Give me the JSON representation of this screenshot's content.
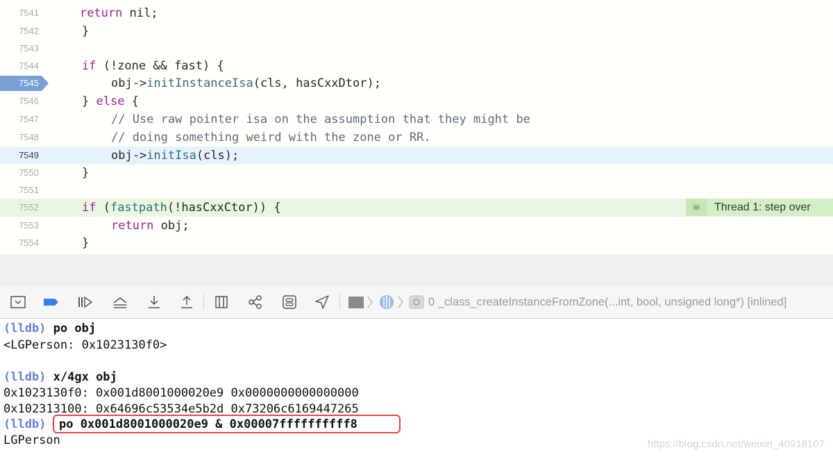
{
  "editor": {
    "lines": [
      {
        "num": "7541"
      },
      {
        "num": "7542"
      },
      {
        "num": "7543"
      },
      {
        "num": "7544"
      },
      {
        "num": "7545"
      },
      {
        "num": "7546"
      },
      {
        "num": "7547"
      },
      {
        "num": "7548"
      },
      {
        "num": "7549"
      },
      {
        "num": "7550"
      },
      {
        "num": "7551"
      },
      {
        "num": "7552"
      },
      {
        "num": "7553"
      },
      {
        "num": "7554"
      }
    ],
    "code": {
      "l7541_kw": "return",
      "l7541_rest": " nil;",
      "l7542": "}",
      "l7544_kw": "if",
      "l7544_rest": " (!zone && fast) {",
      "l7545_a": "obj->",
      "l7545_fn": "initInstanceIsa",
      "l7545_b": "(cls, hasCxxDtor);",
      "l7546_a": "} ",
      "l7546_kw": "else",
      "l7546_b": " {",
      "l7547": "// Use raw pointer isa on the assumption that they might be",
      "l7548": "// doing something weird with the zone or RR.",
      "l7549_a": "obj->",
      "l7549_fn": "initIsa",
      "l7549_b": "(cls);",
      "l7550": "}",
      "l7552_kw": "if",
      "l7552_a": " (",
      "l7552_fn": "fastpath",
      "l7552_b": "(!hasCxxCtor)) {",
      "l7553_kw": "return",
      "l7553_rest": " obj;",
      "l7554": "}"
    },
    "thread_badge": {
      "icon": "≡",
      "text": "Thread 1: step over"
    }
  },
  "toolbar": {
    "frame_label": "0 _class_createInstanceFromZone(...int, bool, unsigned long*) [inlined]"
  },
  "console": {
    "prompt": "(lldb)",
    "cmd1": " po obj",
    "out1": "<LGPerson: 0x1023130f0>",
    "cmd2": " x/4gx obj",
    "out2": "0x1023130f0: 0x001d8001000020e9 0x0000000000000000",
    "out3": "0x102313100: 0x64696c53534e5b2d 0x73206c6169447265",
    "cmd3": "po 0x001d8001000020e9 & 0x00007ffffffffff8",
    "out4": "LGPerson",
    "watermark": "https://blog.csdn.net/weixin_40918107"
  },
  "colors": {
    "keyword": "#9b2393",
    "function": "#326d74",
    "comment": "#5d6c79",
    "breakpoint": "#78a0d7",
    "current_line": "#e8f2fe",
    "thread_line": "#e9f7e2",
    "lldb_prompt": "#6b7fd4",
    "highlight_box": "#e0454b"
  }
}
